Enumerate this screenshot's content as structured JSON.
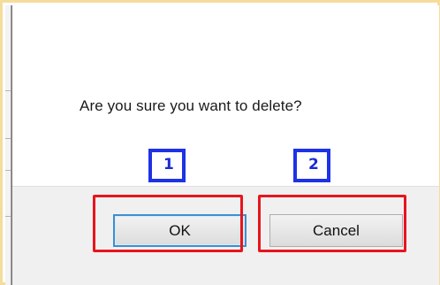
{
  "dialog": {
    "message": "Are you sure you want to delete?",
    "ok_label": "OK",
    "cancel_label": "Cancel"
  },
  "annotations": {
    "badge_1": "1",
    "badge_2": "2",
    "box_color": "#e8141c",
    "badge_color": "#1e32e6"
  }
}
